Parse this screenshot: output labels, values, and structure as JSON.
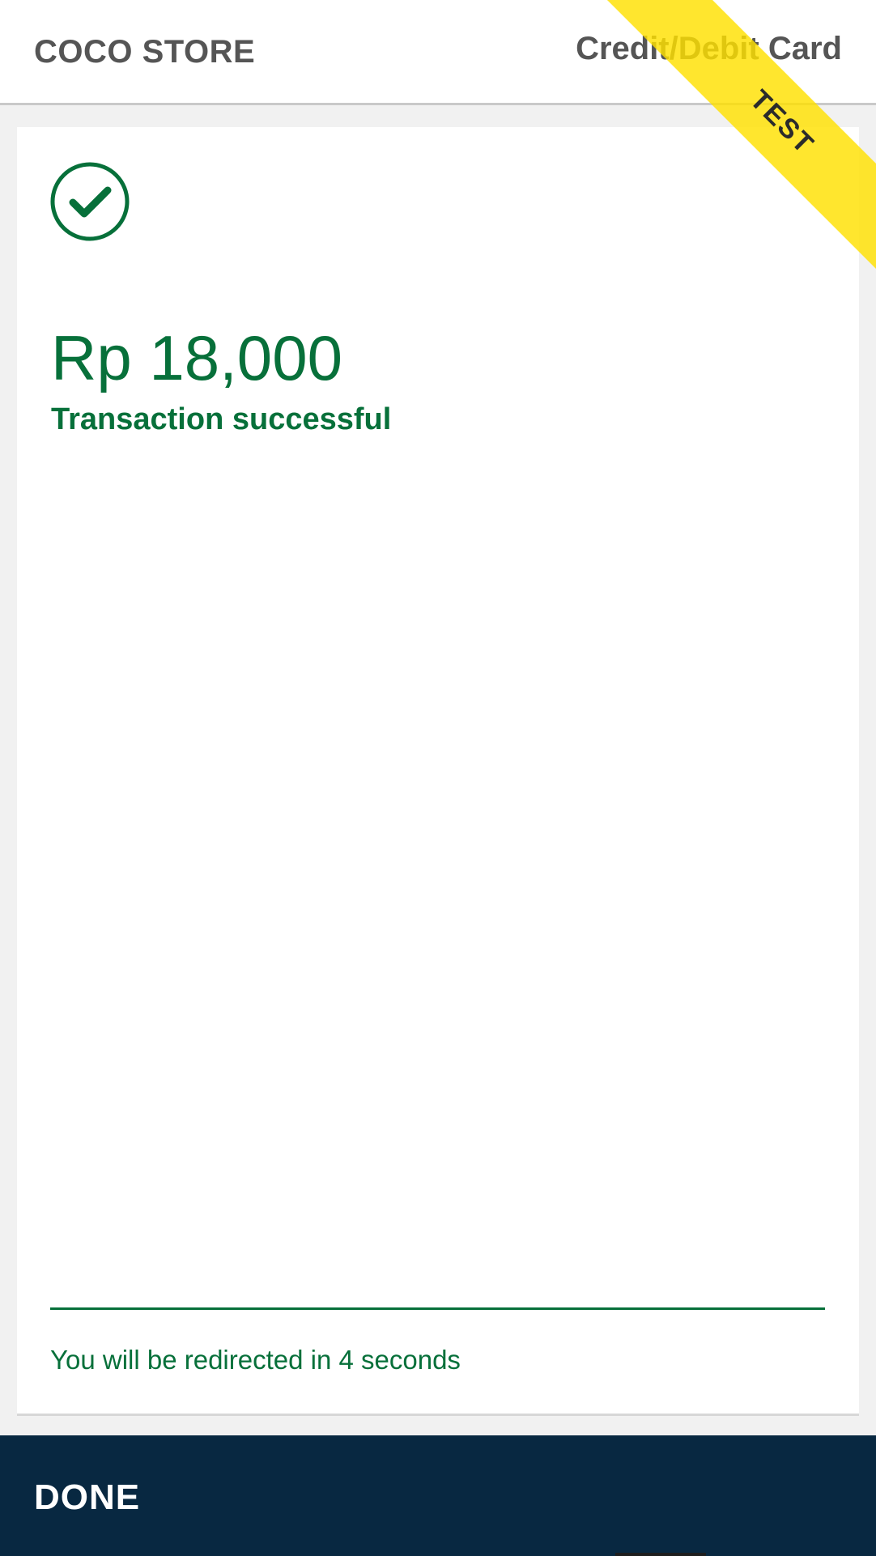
{
  "header": {
    "store_name": "COCO STORE",
    "payment_method": "Credit/Debit Card"
  },
  "badge": {
    "label": "TEST",
    "color": "#FFE000"
  },
  "result": {
    "icon": "check-circle-icon",
    "amount": "Rp 18,000",
    "status": "Transaction successful",
    "redirect_message": "You will be redirected in 4 seconds"
  },
  "footer": {
    "done_label": "DONE"
  },
  "colors": {
    "success": "#07703A",
    "footer_bg": "#082841",
    "header_text": "#555555"
  }
}
